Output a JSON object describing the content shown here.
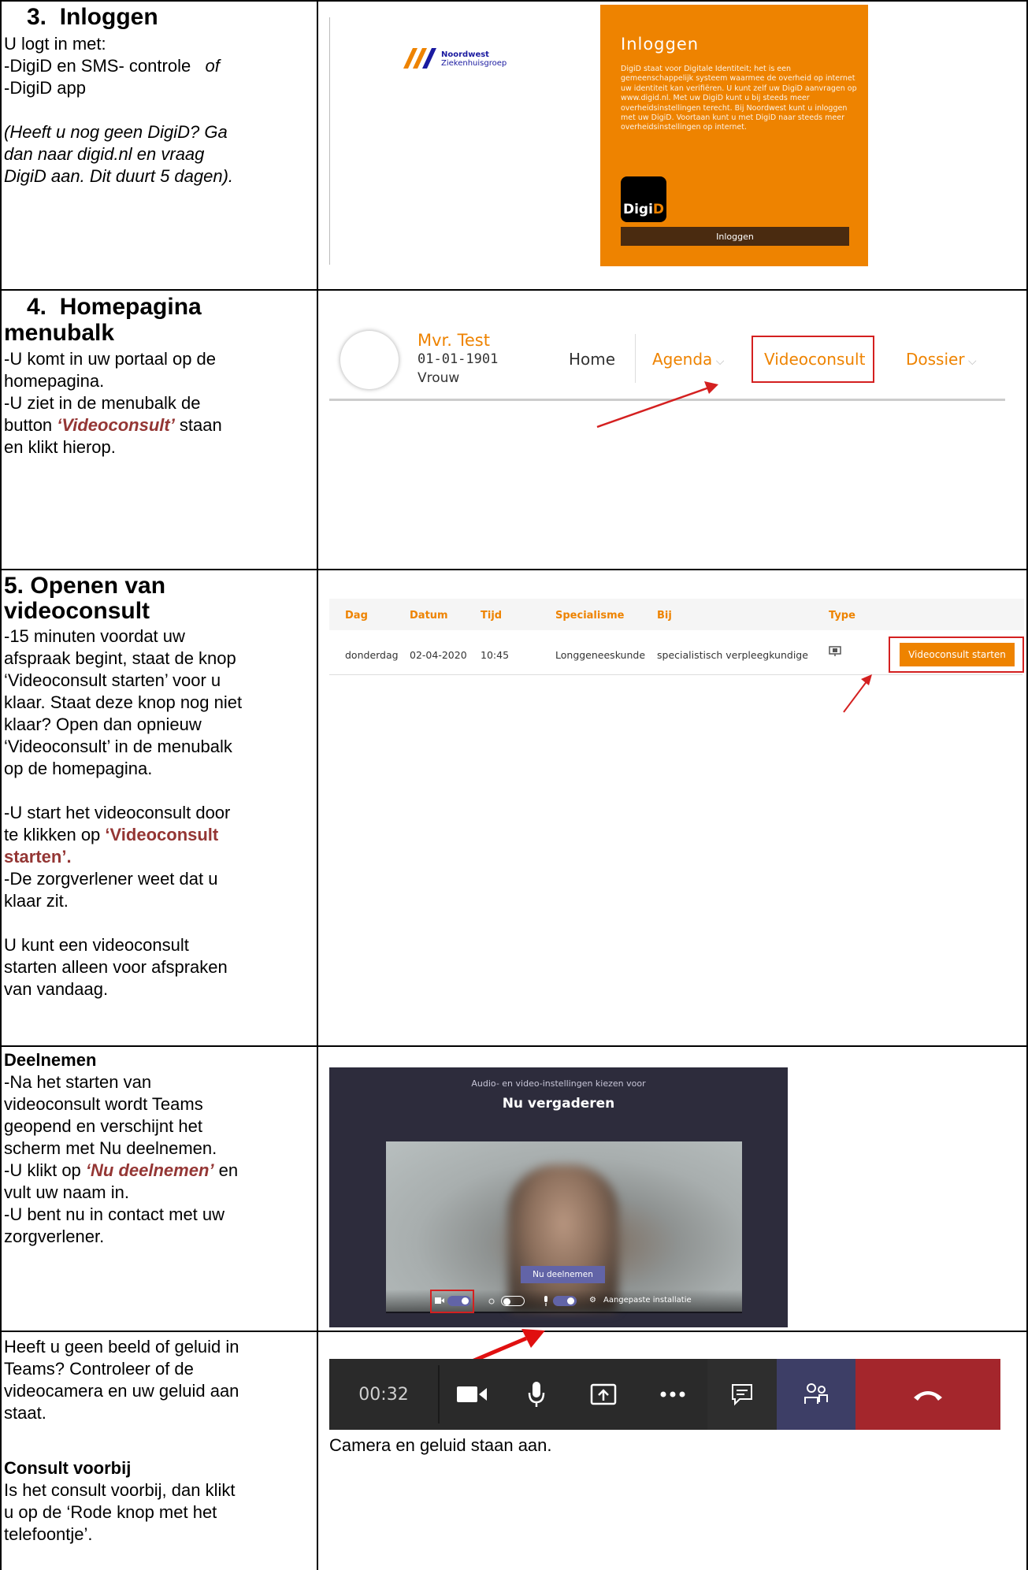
{
  "step3": {
    "heading": "3.  Inloggen",
    "lines": [
      "U logt in met:",
      "-DigiD en SMS- controle",
      "-DigiD app"
    ],
    "of": "of",
    "note_lines": [
      "(Heeft u nog geen DigiD? Ga",
      "dan naar digid.nl en vraag",
      "DigiD aan. Dit duurt 5 dagen)."
    ],
    "image": {
      "logo_line1": "Noordwest",
      "logo_line2": "Ziekenhuisgroep",
      "panel_title": "Inloggen",
      "panel_text": "DigiD staat voor Digitale Identiteit; het is een gemeenschappelijk systeem waarmee de overheid op internet uw identiteit kan verifiëren. U kunt zelf uw DigiD aanvragen op www.digid.nl. Met uw DigiD kunt u bij steeds meer overheidsinstellingen terecht. Bij Noordwest kunt u inloggen met uw DigiD. Voortaan kunt u met DigiD naar steeds meer overheidsinstellingen op internet.",
      "badge_d": "Digi",
      "badge_id": "D",
      "button": "Inloggen"
    }
  },
  "step4": {
    "heading_line1": "4.  Homepagina",
    "heading_line2": "menubalk",
    "lines": [
      "-U komt in uw portaal op de",
      "homepagina.",
      "-U ziet in de menubalk de"
    ],
    "btn_pre": "button ",
    "btn_em": "‘Videoconsult’",
    "btn_post": " staan",
    "last": "en klikt hierop.",
    "image": {
      "name": "Mvr. Test",
      "dob": "01-01-1901",
      "sex": "Vrouw",
      "home": "Home",
      "agenda": "Agenda",
      "videoconsult": "Videoconsult",
      "dossier": "Dossier"
    }
  },
  "step5": {
    "heading_line1": "5. Openen van",
    "heading_line2": "videoconsult",
    "para1": [
      "-15 minuten voordat uw",
      "afspraak begint, staat de knop",
      "‘Videoconsult starten’ voor u",
      "klaar. Staat deze knop nog niet",
      "klaar? Open dan opnieuw",
      "‘Videoconsult’ in de menubalk",
      "op de homepagina."
    ],
    "para2_lines": [
      "-U start het videoconsult door"
    ],
    "para2_pre": "te klikken op ",
    "para2_em1": "‘Videoconsult",
    "para2_em2": "starten’.",
    "para3": [
      "-De zorgverlener weet dat u",
      "klaar zit."
    ],
    "para4": [
      "U kunt een videoconsult",
      "starten alleen voor afspraken",
      "van vandaag."
    ],
    "table": {
      "headers": [
        "Dag",
        "Datum",
        "Tijd",
        "Specialisme",
        "Bij",
        "Type"
      ],
      "row": [
        "donderdag",
        "02-04-2020",
        "10:45",
        "Longgeneeskunde",
        "specialistisch verpleegkundige"
      ],
      "button": "Videoconsult starten"
    }
  },
  "step6": {
    "heading": "Deelnemen",
    "lines": [
      "-Na het starten van",
      "videoconsult wordt Teams",
      "geopend en verschijnt het",
      "scherm met Nu deelnemen."
    ],
    "click_pre": "-U klikt op ",
    "click_em": "‘Nu deelnemen’",
    "click_post": " en",
    "lines2": [
      "vult uw naam in.",
      "-U bent nu in contact met uw",
      "zorgverlener."
    ],
    "image": {
      "subtitle": "Audio- en video-instellingen kiezen voor",
      "title": "Nu vergaderen",
      "join": "Nu deelnemen",
      "custom": "Aangepaste installatie"
    }
  },
  "step7": {
    "lines": [
      "Heeft u geen beeld of geluid in",
      "Teams? Controleer of de",
      "videocamera en uw geluid aan",
      "staat."
    ],
    "consult_heading": "Consult voorbij",
    "consult_lines": [
      "Is het consult voorbij, dan klikt",
      "u op de ‘Rode knop met het",
      "telefoontje’."
    ],
    "callbar": {
      "time": "00:32"
    },
    "caption": "Camera en geluid staan aan."
  },
  "colors": {
    "orange": "#ee8300",
    "accent_red": "#943634",
    "teams_purple": "#6264a7",
    "hangup_red": "#a4262c"
  }
}
